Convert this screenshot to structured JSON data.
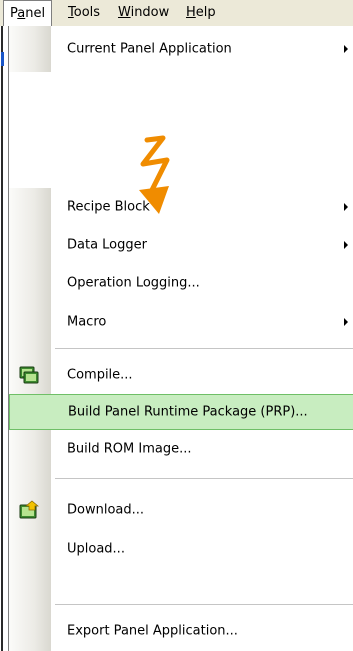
{
  "menubar": {
    "items": [
      {
        "id": "panel",
        "label": "Panel",
        "active": true
      },
      {
        "id": "tools",
        "label": "Tools",
        "active": false
      },
      {
        "id": "window",
        "label": "Window",
        "active": false
      },
      {
        "id": "help",
        "label": "Help",
        "active": false
      }
    ]
  },
  "menu": {
    "items": [
      {
        "label": "Current Panel Application",
        "submenu": true,
        "icon": null
      },
      {
        "label": "Recipe Block",
        "submenu": true,
        "icon": null
      },
      {
        "label": "Data Logger",
        "submenu": true,
        "icon": null
      },
      {
        "label": "Operation Logging...",
        "submenu": false,
        "icon": null
      },
      {
        "label": "Macro",
        "submenu": true,
        "icon": null
      },
      {
        "label": "Compile...",
        "submenu": false,
        "icon": "compile-icon"
      },
      {
        "label": "Build Panel Runtime Package (PRP)...",
        "submenu": false,
        "icon": null,
        "highlighted": true
      },
      {
        "label": "Build ROM Image...",
        "submenu": false,
        "icon": null
      },
      {
        "label": "Download...",
        "submenu": false,
        "icon": "download-icon"
      },
      {
        "label": "Upload...",
        "submenu": false,
        "icon": null
      },
      {
        "label": "Export Panel Application...",
        "submenu": false,
        "icon": null
      }
    ]
  },
  "annotation": {
    "type": "squiggly-arrow",
    "color": "#f08c00"
  },
  "colors": {
    "highlight_bg": "#c8edc0",
    "highlight_border": "#6fbf67",
    "menubar_bg": "#ece9d8"
  }
}
